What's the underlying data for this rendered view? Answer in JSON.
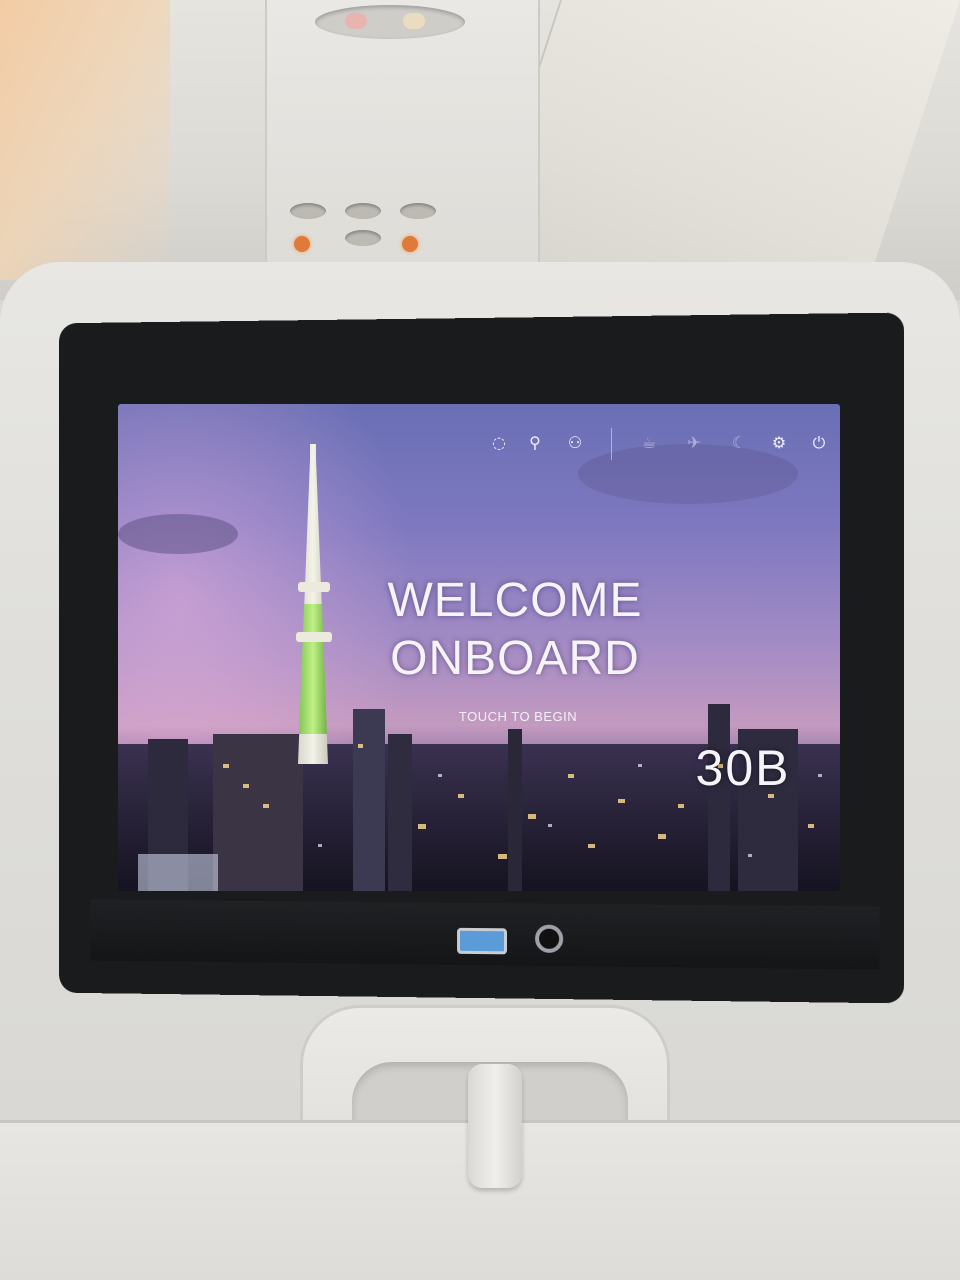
{
  "screen": {
    "welcome_line1": "WELCOME",
    "welcome_line2": "ONBOARD",
    "prompt": "TOUCH TO BEGIN",
    "seat": "30B"
  },
  "top_icons": [
    {
      "name": "brightness-icon",
      "glyph": "◌"
    },
    {
      "name": "attendant-call-icon",
      "glyph": "⚲"
    },
    {
      "name": "flight-map-icon",
      "glyph": "✈"
    },
    {
      "name": "settings-icon",
      "glyph": "⚙"
    },
    {
      "name": "power-icon",
      "glyph": "⏻"
    }
  ],
  "colors": {
    "screen_text": "#f6f4fb",
    "usb_port": "#5a9bd8",
    "call_light": "#e07a3a"
  }
}
